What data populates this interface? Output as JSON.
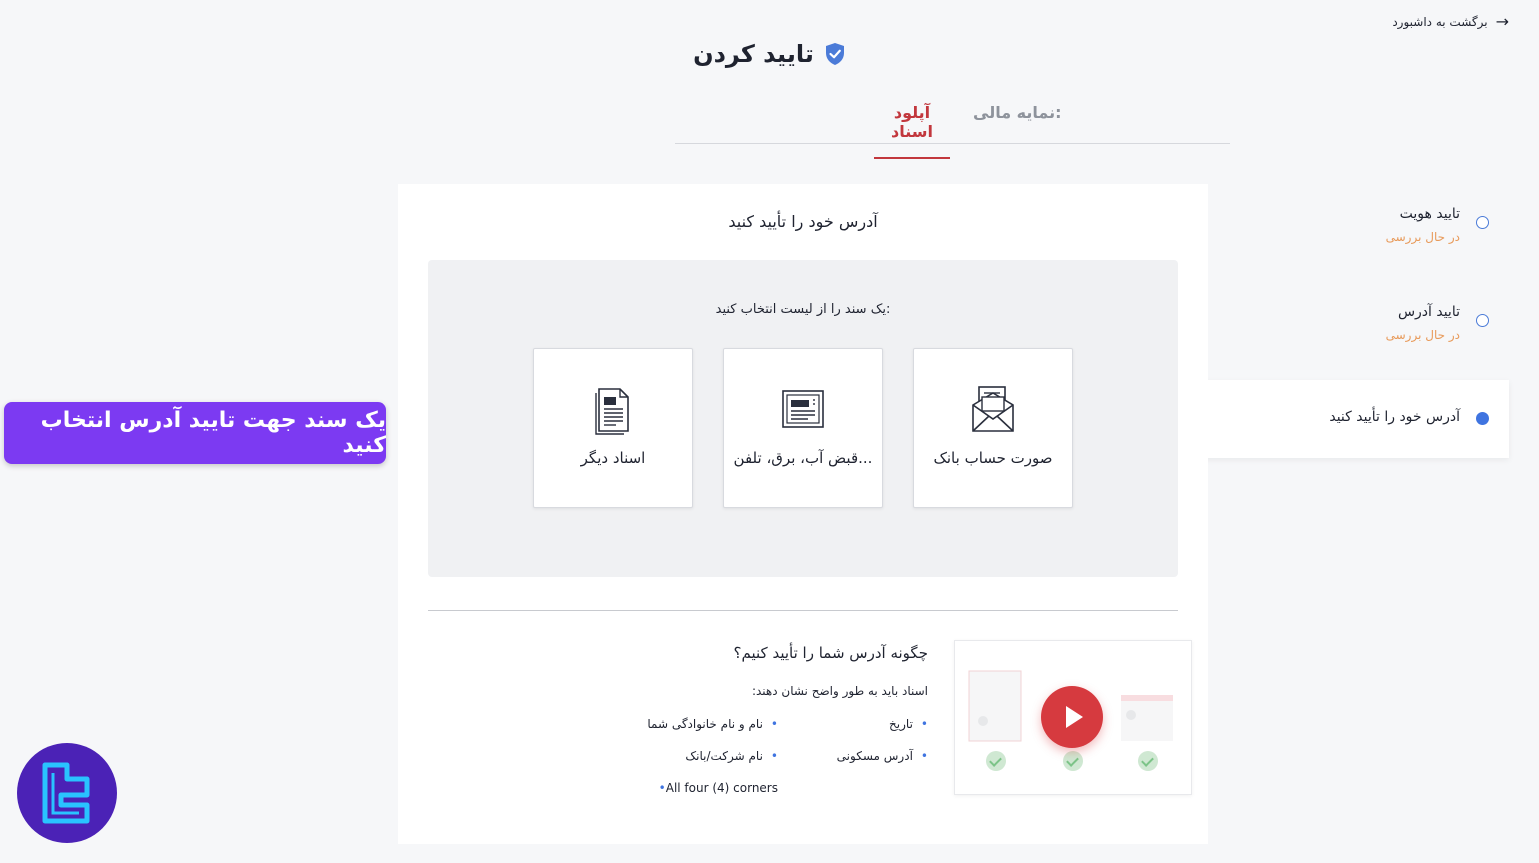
{
  "header": {
    "back_label": "برگشت به داشبورد",
    "title": "تایید کردن"
  },
  "tabs": [
    {
      "label": "آپلود اسناد",
      "active": true
    },
    {
      "label": "نمایه مالی:",
      "active": false
    }
  ],
  "steps": [
    {
      "label": "تایید هویت",
      "status": "در حال بررسی"
    },
    {
      "label": "تایید آدرس",
      "status": "در حال بررسی"
    },
    {
      "label": "آدرس خود را تأیید کنید",
      "active": true
    }
  ],
  "main": {
    "title": "آدرس خود را تأیید کنید",
    "prompt": "یک سند را از لیست انتخاب کنید:",
    "documents": [
      {
        "label": "صورت حساب بانک",
        "icon": "envelope-icon"
      },
      {
        "label": "قبض آب، برق، تلفن...",
        "icon": "bill-icon"
      },
      {
        "label": "اسناد دیگر",
        "icon": "document-icon"
      }
    ],
    "how": {
      "title": "چگونه آدرس شما را تأیید کنیم؟",
      "subtitle": "اسناد باید به طور واضح نشان دهند:",
      "bullets": [
        "تاریخ",
        "نام و نام خانوادگی شما",
        "آدرس مسکونی",
        "نام شرکت/بانک",
        "All four (4) corners"
      ]
    }
  },
  "banner": "یک سند جهت تایید آدرس انتخاب کنید",
  "colors": {
    "accent_red": "#c2373d",
    "accent_blue": "#3f74e0",
    "banner": "#7c3af2",
    "pending": "#e89a5a"
  }
}
